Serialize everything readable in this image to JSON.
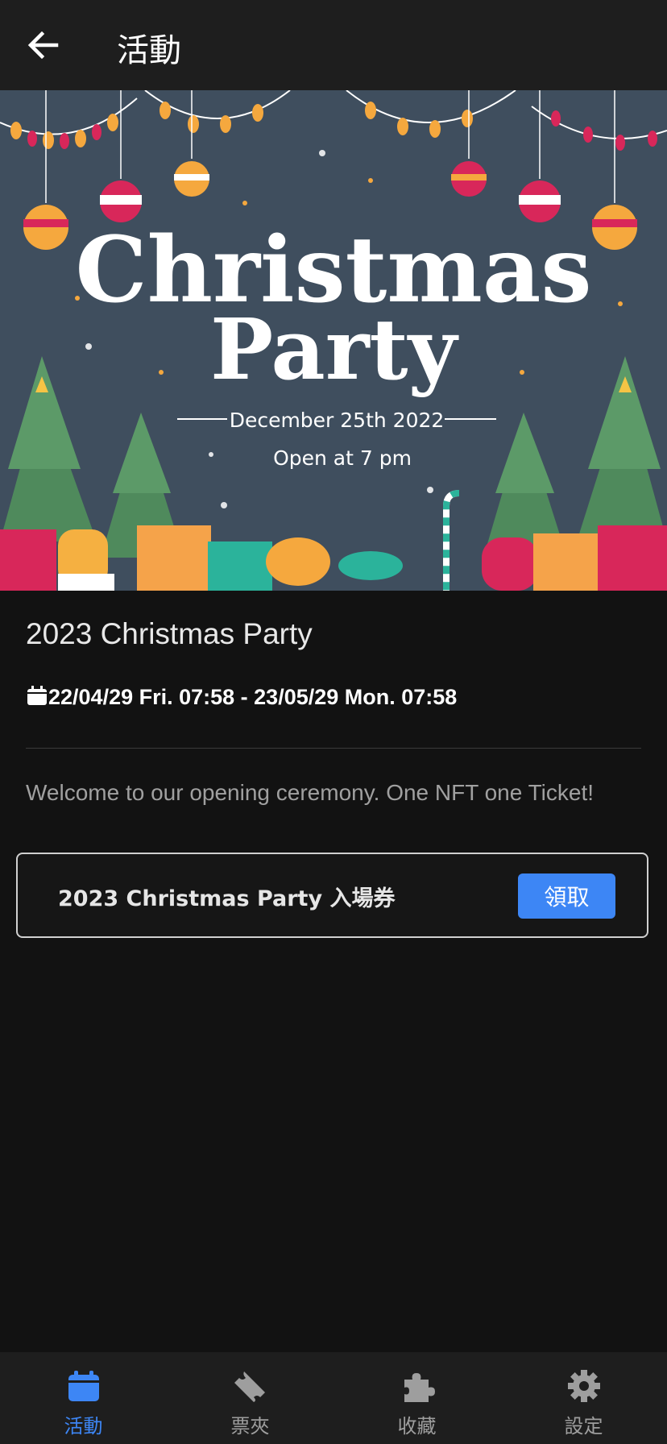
{
  "header": {
    "title": "活動",
    "back_icon": "arrow-left-icon"
  },
  "banner": {
    "headline_line1": "Christmas",
    "headline_line2": "Party",
    "date": "December 25th 2022",
    "time": "Open at 7 pm",
    "background_color": "#3f4e5e"
  },
  "event": {
    "title": "2023 Christmas Party",
    "date_range": "22/04/29 Fri. 07:58 - 23/05/29 Mon. 07:58",
    "description": "Welcome to our opening ceremony. One NFT one Ticket!"
  },
  "ticket": {
    "name": "2023 Christmas Party 入場券",
    "claim_label": "領取"
  },
  "bottom_nav": {
    "items": [
      {
        "label": "活動",
        "icon": "calendar-icon",
        "active": true
      },
      {
        "label": "票夾",
        "icon": "ticket-icon",
        "active": false
      },
      {
        "label": "收藏",
        "icon": "puzzle-icon",
        "active": false
      },
      {
        "label": "設定",
        "icon": "gear-icon",
        "active": false
      }
    ]
  },
  "colors": {
    "accent": "#3d86f5",
    "background": "#121212",
    "bar": "#1e1e1e"
  }
}
